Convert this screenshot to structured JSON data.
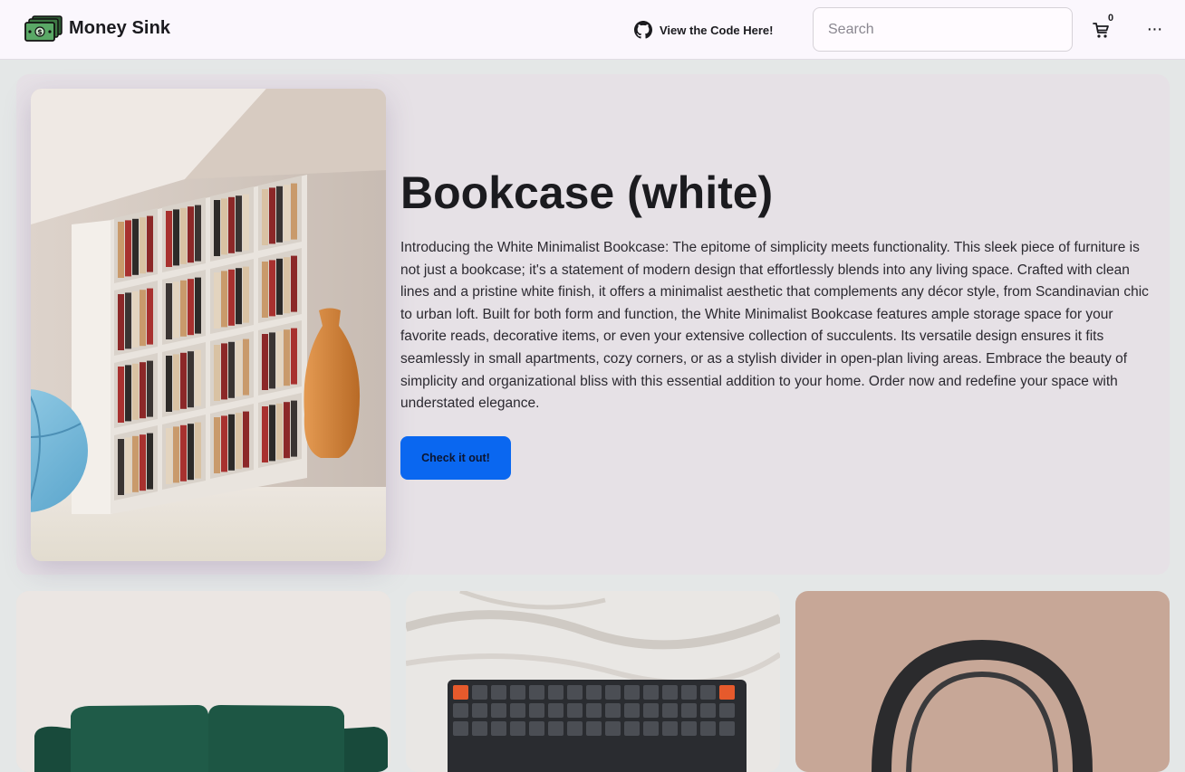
{
  "header": {
    "brand": "Money Sink",
    "code_link_label": "View the Code Here!",
    "search_placeholder": "Search",
    "search_value": "",
    "cart_count": "0",
    "more_label": "···"
  },
  "hero": {
    "title": "Bookcase (white)",
    "description": "Introducing the White Minimalist Bookcase: The epitome of simplicity meets functionality. This sleek piece of furniture is not just a bookcase; it's a statement of modern design that effortlessly blends into any living space. Crafted with clean lines and a pristine white finish, it offers a minimalist aesthetic that complements any décor style, from Scandinavian chic to urban loft. Built for both form and function, the White Minimalist Bookcase features ample storage space for your favorite reads, decorative items, or even your extensive collection of succulents. Its versatile design ensures it fits seamlessly in small apartments, cozy corners, or as a stylish divider in open-plan living areas. Embrace the beauty of simplicity and organizational bliss with this essential addition to your home. Order now and redefine your space with understated elegance.",
    "button_label": "Check it out!"
  },
  "products": [
    {
      "image": "green-sofa"
    },
    {
      "image": "mechanical-keyboard"
    },
    {
      "image": "headphones"
    }
  ],
  "colors": {
    "accent": "#0a67f0",
    "header_bg": "#fbf7fd",
    "hero_bg": "#e6e1e6",
    "page_bg": "#e4e7e7"
  }
}
